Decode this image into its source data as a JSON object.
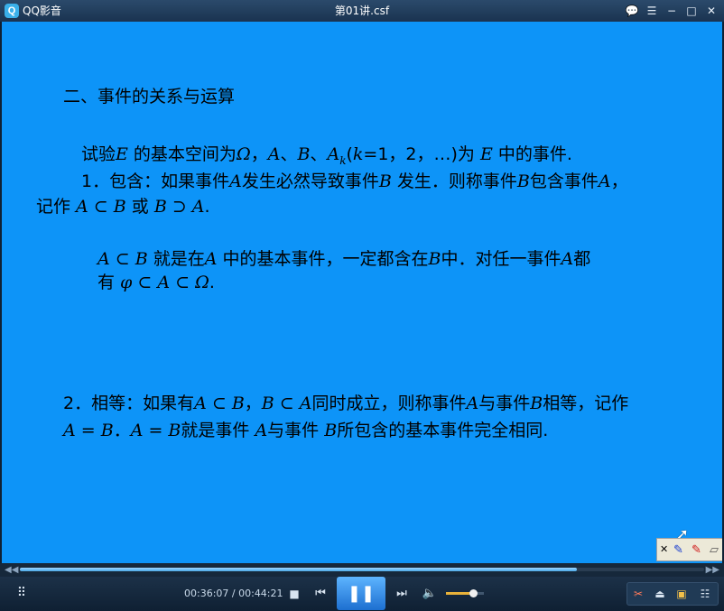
{
  "window": {
    "app_name": "QQ影音",
    "file_name": "第01讲.csf",
    "buttons": {
      "chat": "💬",
      "list": "☰",
      "minimize": "−",
      "maximize": "□",
      "close": "✕"
    }
  },
  "slide": {
    "heading": "二、事件的关系与运算",
    "line1": {
      "a": "试验",
      "E": "E",
      "b": " 的基本空间为",
      "omega": "Ω",
      "c": "，",
      "A": "A",
      "d": "、",
      "B": "B",
      "e": "、",
      "Ak": "A",
      "k_sub": "k",
      "f": "(",
      "k": "k",
      "g": "=1，2，…)为 ",
      "E2": "E",
      "h": " 中的事件."
    },
    "line2": {
      "a": "1．包含：如果事件",
      "A": "A",
      "b": "发生必然导致事件",
      "B": "B",
      "c": " 发生．则称事件",
      "B2": "B",
      "d": "包含事件",
      "A2": "A",
      "e": "，"
    },
    "line3": {
      "a": "记作 ",
      "f1": "A ⊂ B",
      "b": " 或 ",
      "f2": "B ⊃ A",
      "c": "."
    },
    "line4": {
      "f": "A ⊂ B",
      "a": " 就是在",
      "A": "A",
      "b": " 中的基本事件，一定都含在",
      "B": "B",
      "c": "中．对任一事件",
      "A2": "A",
      "d": "都"
    },
    "line5": {
      "a": "有 ",
      "f": "φ ⊂ A ⊂ Ω",
      "b": "."
    },
    "line6": {
      "a": "2．相等：如果有",
      "f1": "A ⊂ B",
      "b": "，",
      "f2": "B ⊂ A",
      "c": "同时成立，则称事件",
      "A": "A",
      "d": "与事件",
      "B": "B",
      "e": "相等，记作"
    },
    "line7": {
      "f1": "A = B",
      "a": "．",
      "f2": "A = B",
      "b": "就是事件 ",
      "A": "A",
      "c": "与事件 ",
      "B": "B",
      "d": "所包含的基本事件完全相同."
    }
  },
  "pen_toolbar": {
    "close": "✕",
    "pen": "✎",
    "marker": "✎",
    "eraser": "▱"
  },
  "player": {
    "current_time": "00:36:07",
    "separator": " / ",
    "total_time": "00:44:21",
    "progress_fraction": 0.814,
    "volume_fraction": 0.72,
    "icons": {
      "footprint": "footprint-icon",
      "stop": "■",
      "prev": "⏮",
      "pause": "❚❚",
      "next": "⏭",
      "volume": "🔈",
      "tools": "✂",
      "eject": "⏏",
      "screenshot": "▣",
      "menu": "☷"
    },
    "seek_left": "◀◀",
    "seek_right": "▶▶"
  }
}
